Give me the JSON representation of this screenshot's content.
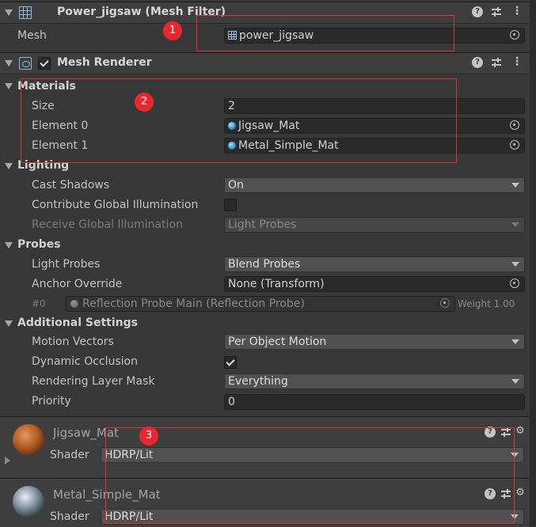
{
  "mesh_filter": {
    "title": "Power_jigsaw (Mesh Filter)",
    "mesh_label": "Mesh",
    "mesh_value": "power_jigsaw",
    "icon": "mesh-filter-icon"
  },
  "mesh_renderer": {
    "title": "Mesh Renderer",
    "enabled": true,
    "icon": "mesh-renderer-icon"
  },
  "materials": {
    "label": "Materials",
    "size_label": "Size",
    "size_value": "2",
    "element0_label": "Element 0",
    "element0_value": "Jigsaw_Mat",
    "element1_label": "Element 1",
    "element1_value": "Metal_Simple_Mat"
  },
  "lighting": {
    "label": "Lighting",
    "cast_shadows_label": "Cast Shadows",
    "cast_shadows_value": "On",
    "contribute_gi_label": "Contribute Global Illumination",
    "contribute_gi_checked": false,
    "receive_gi_label": "Receive Global Illumination",
    "receive_gi_value": "Light Probes"
  },
  "probes": {
    "label": "Probes",
    "light_probes_label": "Light Probes",
    "light_probes_value": "Blend Probes",
    "anchor_override_label": "Anchor Override",
    "anchor_override_value": "None (Transform)",
    "reflection_index": "#0",
    "reflection_probe_value": "Reflection Probe Main (Reflection Probe)",
    "reflection_weight": "Weight 1.00"
  },
  "additional_settings": {
    "label": "Additional Settings",
    "motion_vectors_label": "Motion Vectors",
    "motion_vectors_value": "Per Object Motion",
    "dynamic_occlusion_label": "Dynamic Occlusion",
    "dynamic_occlusion_checked": true,
    "rendering_layer_mask_label": "Rendering Layer Mask",
    "rendering_layer_mask_value": "Everything",
    "priority_label": "Priority",
    "priority_value": "0"
  },
  "material_panels": [
    {
      "name": "Jigsaw_Mat",
      "shader_label": "Shader",
      "shader_value": "HDRP/Lit"
    },
    {
      "name": "Metal_Simple_Mat",
      "shader_label": "Shader",
      "shader_value": "HDRP/Lit"
    }
  ],
  "annotations": [
    "1",
    "2",
    "3"
  ],
  "colors": {
    "background": "#383838",
    "header": "#3e3e3e",
    "field": "#2a2a2a",
    "dropdown": "#515151",
    "annotation_red": "#e0323c"
  }
}
